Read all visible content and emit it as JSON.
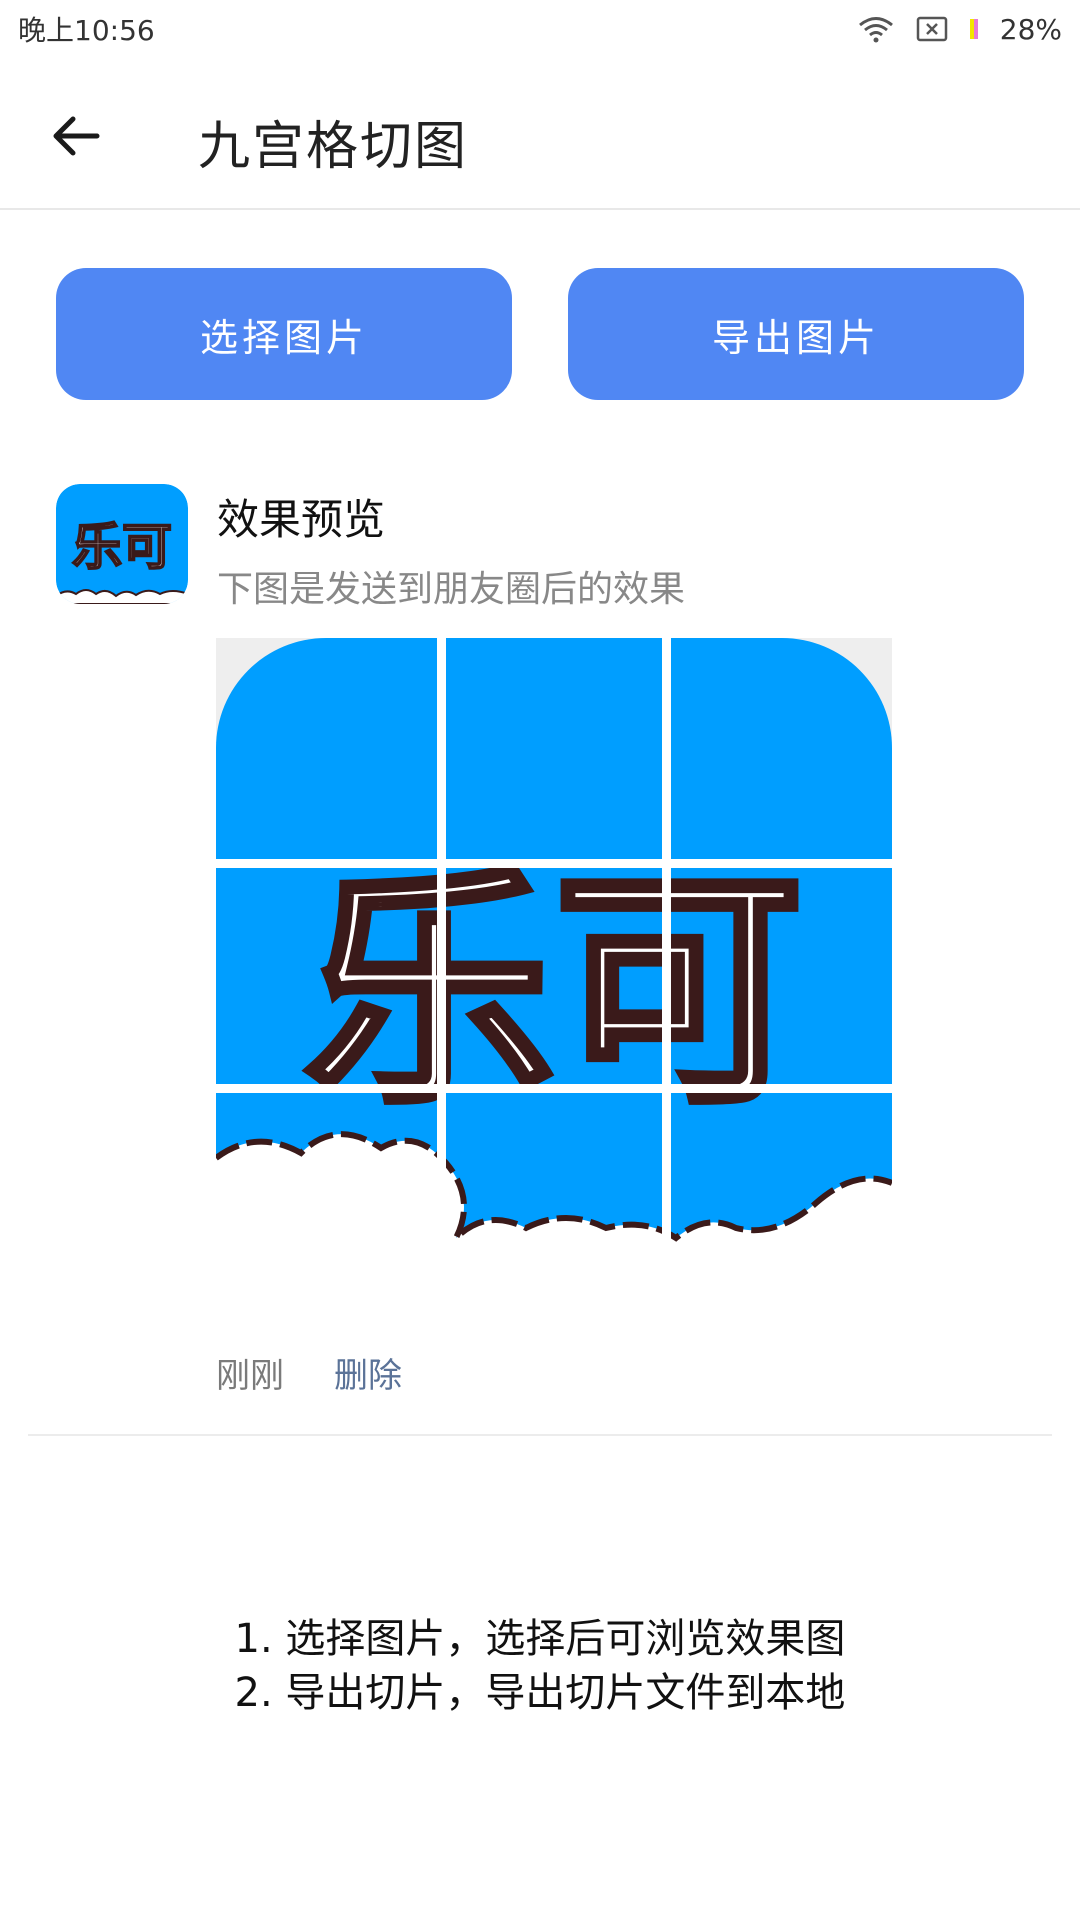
{
  "status_bar": {
    "time": "晚上10:56",
    "battery": "28%",
    "icons": [
      "wifi-icon",
      "sim-off-icon",
      "battery-icon"
    ]
  },
  "app_bar": {
    "title": "九宫格切图",
    "back_icon": "arrow-left-icon"
  },
  "actions": {
    "select_label": "选择图片",
    "export_label": "导出图片",
    "accent_color": "#5087f3"
  },
  "preview": {
    "title": "效果预览",
    "subtitle": "下图是发送到朋友圈后的效果",
    "avatar_text": "乐可",
    "image_text": "乐可",
    "time": "刚刚",
    "delete_label": "删除",
    "image_color": "#009eff"
  },
  "instructions": {
    "line1": "1. 选择图片，选择后可浏览效果图",
    "line2": "2. 导出切片，导出切片文件到本地"
  }
}
